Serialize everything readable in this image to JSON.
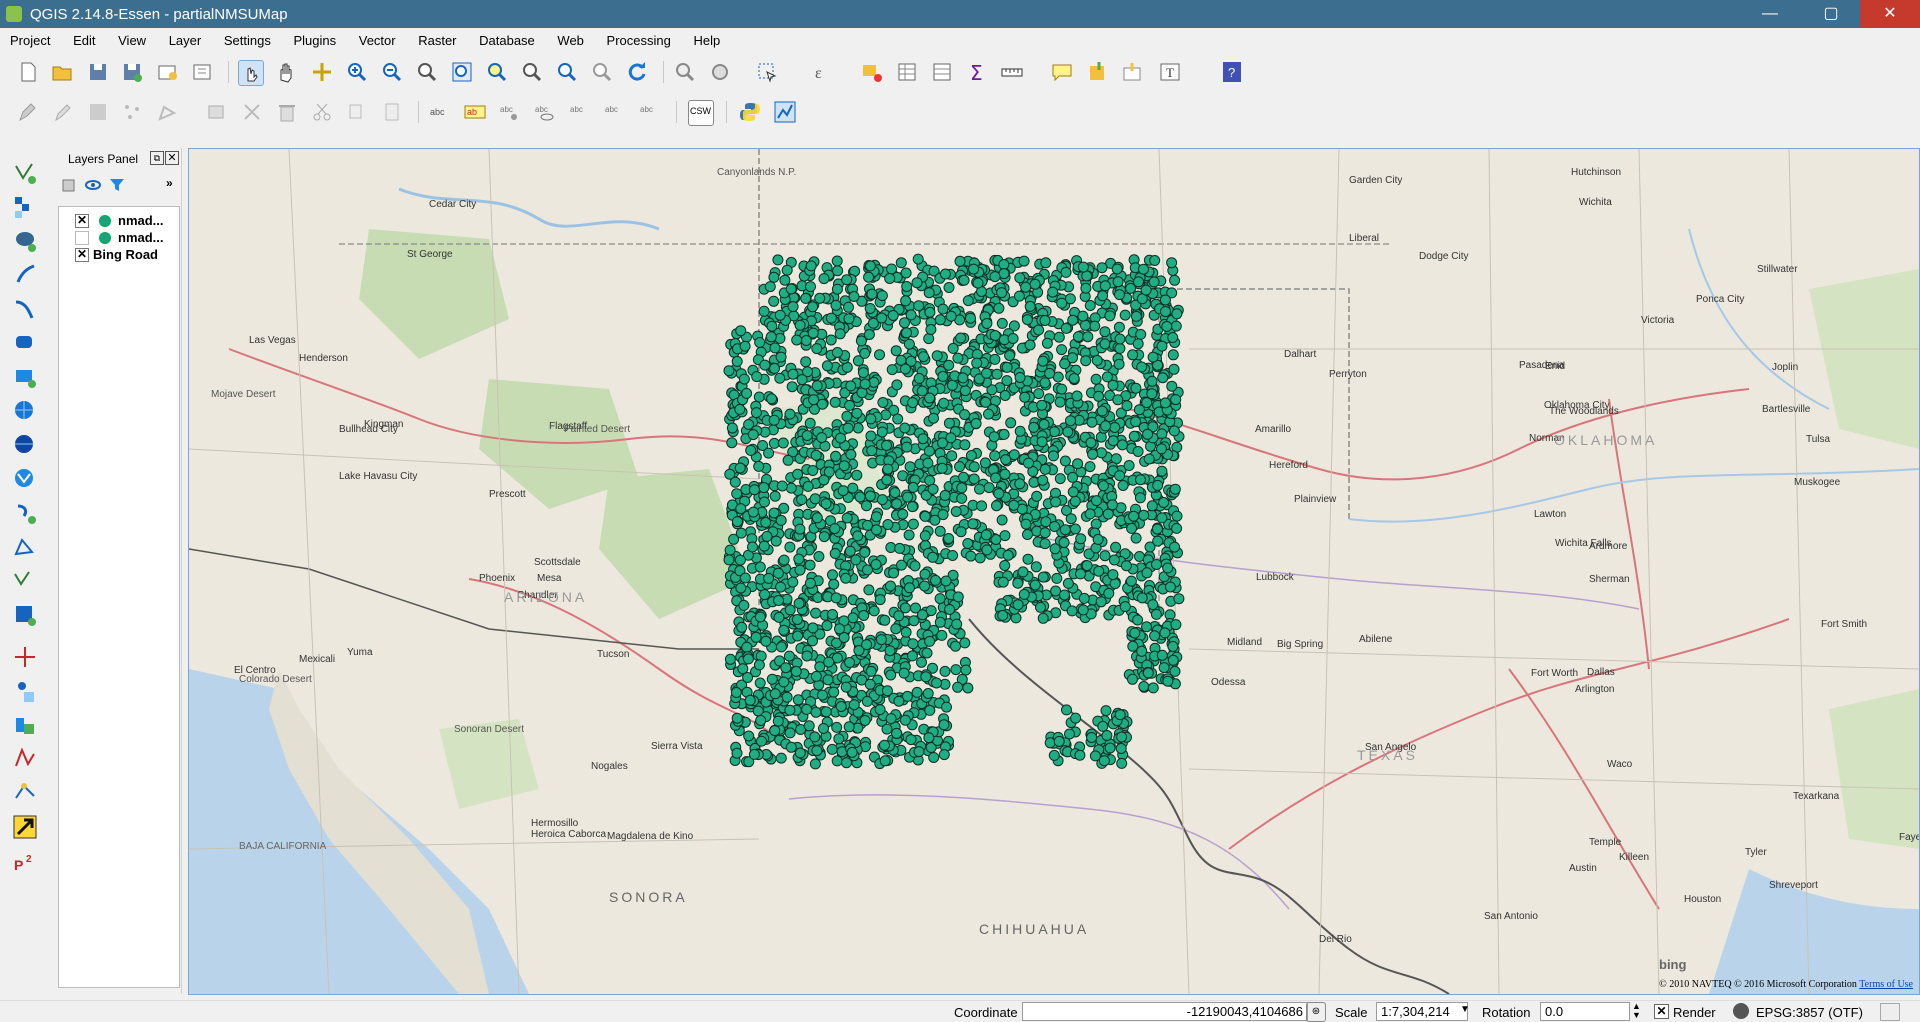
{
  "window": {
    "title": "QGIS 2.14.8-Essen - partialNMSUMap",
    "minimize": "—",
    "maximize": "▢",
    "close": "✕"
  },
  "menu": [
    "Project",
    "Edit",
    "View",
    "Layer",
    "Settings",
    "Plugins",
    "Vector",
    "Raster",
    "Database",
    "Web",
    "Processing",
    "Help"
  ],
  "toolbar": {
    "csw_label": "CSW"
  },
  "layers_panel": {
    "title": "Layers Panel",
    "layers": [
      {
        "name": "nmad...",
        "checked": true,
        "symbol": "point",
        "color": "#1aa37a"
      },
      {
        "name": "nmad...",
        "checked": false,
        "symbol": "point",
        "color": "#1aa37a"
      },
      {
        "name": "Bing Road",
        "checked": true,
        "symbol": "none"
      }
    ]
  },
  "map": {
    "attribution": "© 2010 NAVTEQ © 2016 Microsoft Corporation",
    "terms": "Terms of Use",
    "logo": "bing",
    "point_color": "#1fae84",
    "labels": [
      {
        "text": "Canyonlands N.P.",
        "c": "#555"
      },
      {
        "text": "Garden City",
        "c": "#333"
      },
      {
        "text": "Hutchinson",
        "c": "#333"
      },
      {
        "text": "Wichita",
        "c": "#333"
      },
      {
        "text": "Cedar City",
        "c": "#333"
      },
      {
        "text": "St George",
        "c": "#333"
      },
      {
        "text": "Las Vegas",
        "c": "#333"
      },
      {
        "text": "Henderson",
        "c": "#333"
      },
      {
        "text": "Kingman",
        "c": "#333"
      },
      {
        "text": "Flagstaff",
        "c": "#333"
      },
      {
        "text": "Prescott",
        "c": "#333"
      },
      {
        "text": "Phoenix",
        "c": "#333"
      },
      {
        "text": "Scottsdale",
        "c": "#333"
      },
      {
        "text": "Mesa",
        "c": "#333"
      },
      {
        "text": "Chandler",
        "c": "#333"
      },
      {
        "text": "Tucson",
        "c": "#333"
      },
      {
        "text": "Yuma",
        "c": "#333"
      },
      {
        "text": "Mexicali",
        "c": "#333"
      },
      {
        "text": "El Centro",
        "c": "#333"
      },
      {
        "text": "Nogales",
        "c": "#333"
      },
      {
        "text": "Sierra Vista",
        "c": "#333"
      },
      {
        "text": "Amarillo",
        "c": "#333"
      },
      {
        "text": "Lubbock",
        "c": "#333"
      },
      {
        "text": "Odessa",
        "c": "#333"
      },
      {
        "text": "Midland",
        "c": "#333"
      },
      {
        "text": "Abilene",
        "c": "#333"
      },
      {
        "text": "Big Spring",
        "c": "#333"
      },
      {
        "text": "San Angelo",
        "c": "#333"
      },
      {
        "text": "Oklahoma City",
        "c": "#333"
      },
      {
        "text": "Norman",
        "c": "#333"
      },
      {
        "text": "Wichita Falls",
        "c": "#333"
      },
      {
        "text": "Fort Worth",
        "c": "#333"
      },
      {
        "text": "Dallas",
        "c": "#333"
      },
      {
        "text": "Arlington",
        "c": "#333"
      },
      {
        "text": "Austin",
        "c": "#333"
      },
      {
        "text": "San Antonio",
        "c": "#333"
      },
      {
        "text": "Houston",
        "c": "#333"
      },
      {
        "text": "Del Rio",
        "c": "#333"
      },
      {
        "text": "Hermosillo",
        "c": "#333"
      },
      {
        "text": "Heroica Caborca",
        "c": "#333"
      },
      {
        "text": "Magdalena de Kino",
        "c": "#333"
      },
      {
        "text": "CHIHUAHUA",
        "c": "#666"
      },
      {
        "text": "SONORA",
        "c": "#666"
      },
      {
        "text": "BAJA CALIFORNIA",
        "c": "#666"
      },
      {
        "text": "ARIZONA",
        "c": "#999"
      },
      {
        "text": "TEXAS",
        "c": "#999"
      },
      {
        "text": "OKLAHOMA",
        "c": "#999"
      },
      {
        "text": "Lake Havasu City",
        "c": "#333"
      },
      {
        "text": "Bullhead City",
        "c": "#333"
      },
      {
        "text": "Mojave Desert",
        "c": "#555"
      },
      {
        "text": "Sonoran Desert",
        "c": "#555"
      },
      {
        "text": "Colorado Desert",
        "c": "#555"
      },
      {
        "text": "Painted Desert",
        "c": "#555"
      },
      {
        "text": "Plainview",
        "c": "#333"
      },
      {
        "text": "Dalhart",
        "c": "#333"
      },
      {
        "text": "Hereford",
        "c": "#333"
      },
      {
        "text": "Perryton",
        "c": "#333"
      },
      {
        "text": "Liberal",
        "c": "#333"
      },
      {
        "text": "Dodge City",
        "c": "#333"
      },
      {
        "text": "Enid",
        "c": "#333"
      },
      {
        "text": "Lawton",
        "c": "#333"
      },
      {
        "text": "Ardmore",
        "c": "#333"
      },
      {
        "text": "Sherman",
        "c": "#333"
      },
      {
        "text": "Waco",
        "c": "#333"
      },
      {
        "text": "Temple",
        "c": "#333"
      },
      {
        "text": "Killeen",
        "c": "#333"
      },
      {
        "text": "Tyler",
        "c": "#333"
      },
      {
        "text": "Shreveport",
        "c": "#333"
      },
      {
        "text": "Texarkana",
        "c": "#333"
      },
      {
        "text": "Fayetteville",
        "c": "#333"
      },
      {
        "text": "Fort Smith",
        "c": "#333"
      },
      {
        "text": "Muskogee",
        "c": "#333"
      },
      {
        "text": "Tulsa",
        "c": "#333"
      },
      {
        "text": "Joplin",
        "c": "#333"
      },
      {
        "text": "Bartlesville",
        "c": "#333"
      },
      {
        "text": "Ponca City",
        "c": "#333"
      },
      {
        "text": "Stillwater",
        "c": "#333"
      },
      {
        "text": "Victoria",
        "c": "#333"
      },
      {
        "text": "Pasadena",
        "c": "#333"
      },
      {
        "text": "The Woodlands",
        "c": "#333"
      }
    ]
  },
  "status": {
    "coordinate_label": "Coordinate",
    "coordinate_value": "-12190043,4104686",
    "scale_label": "Scale",
    "scale_value": "1:7,304,214",
    "rotation_label": "Rotation",
    "rotation_value": "0.0",
    "render_label": "Render",
    "crs": "EPSG:3857 (OTF)"
  }
}
